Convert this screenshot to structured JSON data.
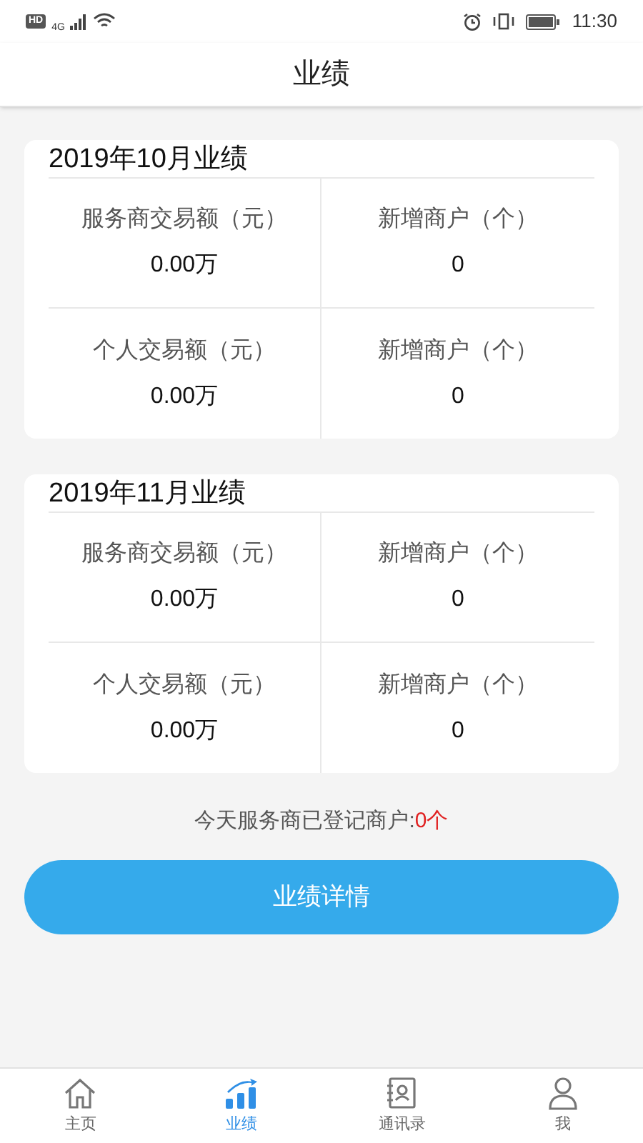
{
  "status_bar": {
    "hd": "HD",
    "network": "4G",
    "time": "11:30"
  },
  "header": {
    "title": "业绩"
  },
  "cards": [
    {
      "title": "2019年10月业绩",
      "cells": [
        {
          "label": "服务商交易额（元）",
          "value": "0.00万"
        },
        {
          "label": "新增商户（个）",
          "value": "0"
        },
        {
          "label": "个人交易额（元）",
          "value": "0.00万"
        },
        {
          "label": "新增商户（个）",
          "value": "0"
        }
      ]
    },
    {
      "title": "2019年11月业绩",
      "cells": [
        {
          "label": "服务商交易额（元）",
          "value": "0.00万"
        },
        {
          "label": "新增商户（个）",
          "value": "0"
        },
        {
          "label": "个人交易额（元）",
          "value": "0.00万"
        },
        {
          "label": "新增商户（个）",
          "value": "0"
        }
      ]
    }
  ],
  "summary": {
    "text": "今天服务商已登记商户:",
    "count": "0个"
  },
  "button": {
    "label": "业绩详情"
  },
  "nav": [
    {
      "kind": "home",
      "label": "主页",
      "selected": false
    },
    {
      "kind": "chart",
      "label": "业绩",
      "selected": true
    },
    {
      "kind": "contacts",
      "label": "通讯录",
      "selected": false
    },
    {
      "kind": "profile",
      "label": "我",
      "selected": false
    }
  ]
}
